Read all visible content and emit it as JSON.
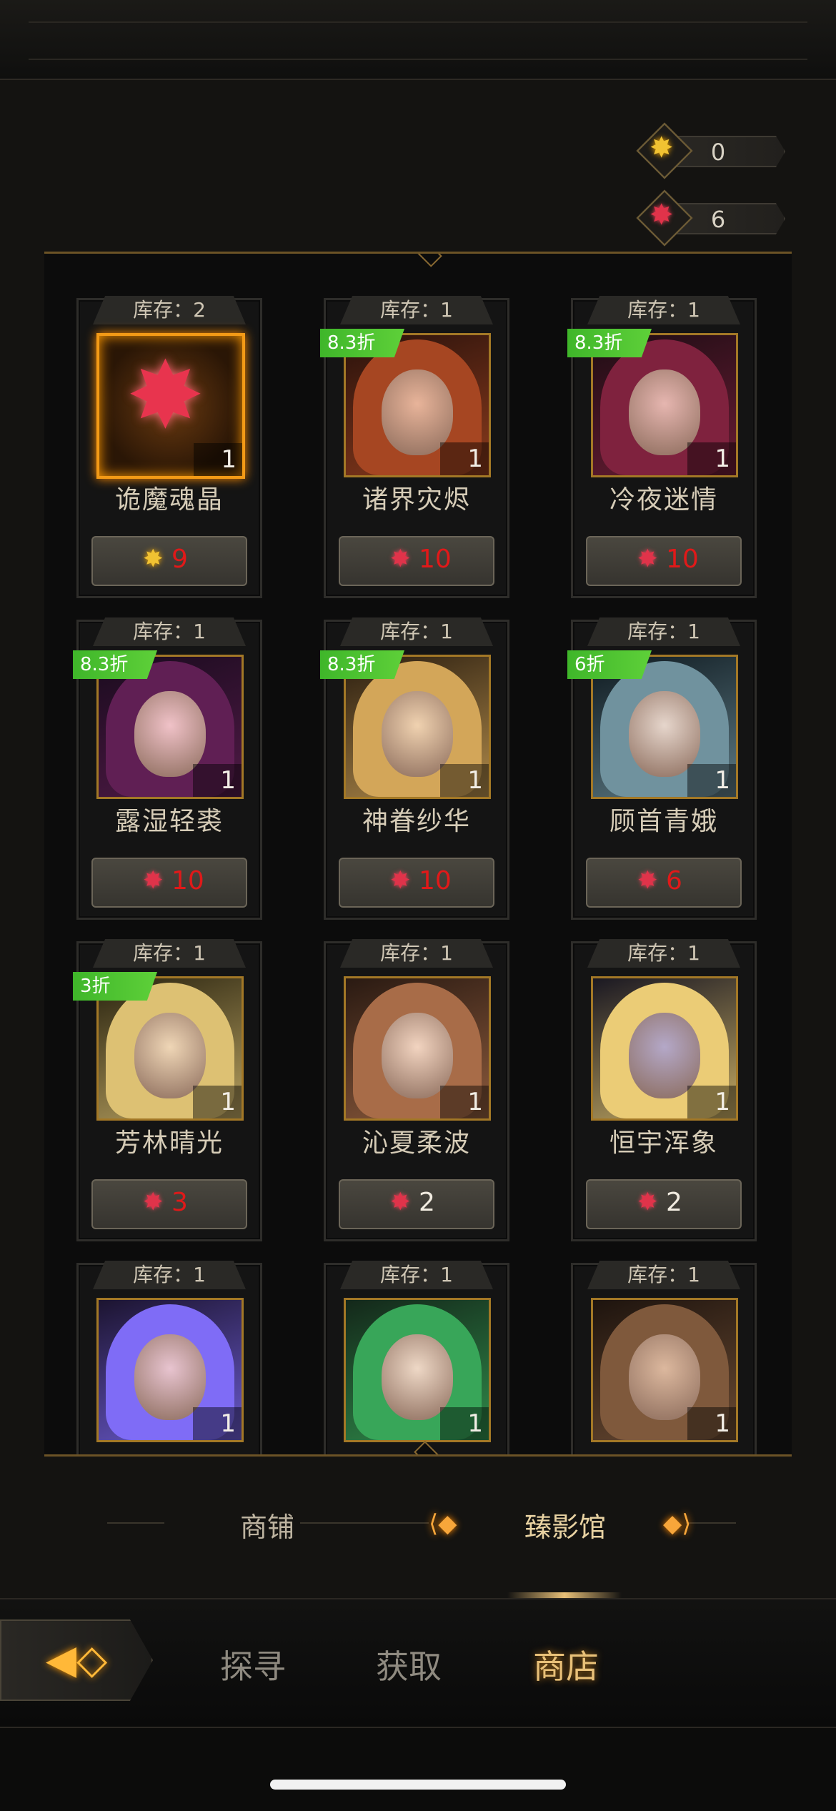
{
  "currencies": [
    {
      "icon": "gold-star-gem-icon",
      "value": "0"
    },
    {
      "icon": "red-star-gem-icon",
      "value": "6"
    }
  ],
  "stock_prefix": "库存：",
  "items": [
    {
      "stock": "库存：2",
      "name": "诡魔魂晶",
      "qty": "1",
      "price": "9",
      "price_icon": "gold",
      "discount": "",
      "glow": true
    },
    {
      "stock": "库存：1",
      "name": "诸界灾烬",
      "qty": "1",
      "price": "10",
      "price_icon": "red",
      "discount": "8.3折"
    },
    {
      "stock": "库存：1",
      "name": "冷夜迷情",
      "qty": "1",
      "price": "10",
      "price_icon": "red",
      "discount": "8.3折"
    },
    {
      "stock": "库存：1",
      "name": "露湿轻裘",
      "qty": "1",
      "price": "10",
      "price_icon": "red",
      "discount": "8.3折"
    },
    {
      "stock": "库存：1",
      "name": "神眷纱华",
      "qty": "1",
      "price": "10",
      "price_icon": "red",
      "discount": "8.3折"
    },
    {
      "stock": "库存：1",
      "name": "顾首青娥",
      "qty": "1",
      "price": "6",
      "price_icon": "red",
      "discount": "6折"
    },
    {
      "stock": "库存：1",
      "name": "芳林晴光",
      "qty": "1",
      "price": "3",
      "price_icon": "red",
      "discount": "3折"
    },
    {
      "stock": "库存：1",
      "name": "沁夏柔波",
      "qty": "1",
      "price": "2",
      "price_icon": "red",
      "discount": ""
    },
    {
      "stock": "库存：1",
      "name": "恒宇浑象",
      "qty": "1",
      "price": "2",
      "price_icon": "red",
      "discount": ""
    },
    {
      "stock": "库存：1",
      "name": "",
      "qty": "1",
      "price": "",
      "price_icon": "",
      "discount": ""
    },
    {
      "stock": "库存：1",
      "name": "",
      "qty": "1",
      "price": "",
      "price_icon": "",
      "discount": ""
    },
    {
      "stock": "库存：1",
      "name": "",
      "qty": "1",
      "price": "",
      "price_icon": "",
      "discount": ""
    }
  ],
  "tabs": {
    "shop": "商铺",
    "gallery": "臻影馆"
  },
  "nav": {
    "explore": "探寻",
    "obtain": "获取",
    "store": "商店"
  },
  "colors": {
    "accent_gold": "#e8c078",
    "discount_green": "#4cc331",
    "price_red": "#e01919"
  }
}
